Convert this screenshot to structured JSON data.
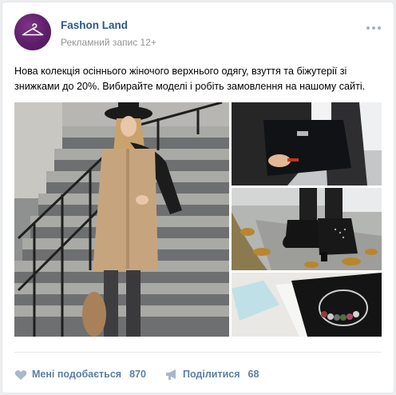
{
  "post": {
    "author": "Fashon Land",
    "meta": "Рекламний запис 12+",
    "text": "Нова колекція осіннього жіночого верхнього одягу, взуття та біжутерії зі знижками до 20%. Вибирайте моделі і робіть замовлення на нашому сайті.",
    "avatar_icon": "hanger-icon",
    "more_icon": "more-dots-icon"
  },
  "gallery": {
    "photos": [
      "woman-in-beige-coat-photo",
      "black-clutch-bag-photo",
      "ankle-boots-photo",
      "bracelet-in-box-photo"
    ]
  },
  "actions": {
    "like_label": "Мені подобається",
    "like_count": "870",
    "like_icon": "heart-icon",
    "share_label": "Поділитися",
    "share_count": "68",
    "share_icon": "megaphone-icon"
  },
  "colors": {
    "link": "#2a5885",
    "action": "#5b7ea3",
    "meta": "#939393",
    "avatar": "#5d1f6a"
  }
}
